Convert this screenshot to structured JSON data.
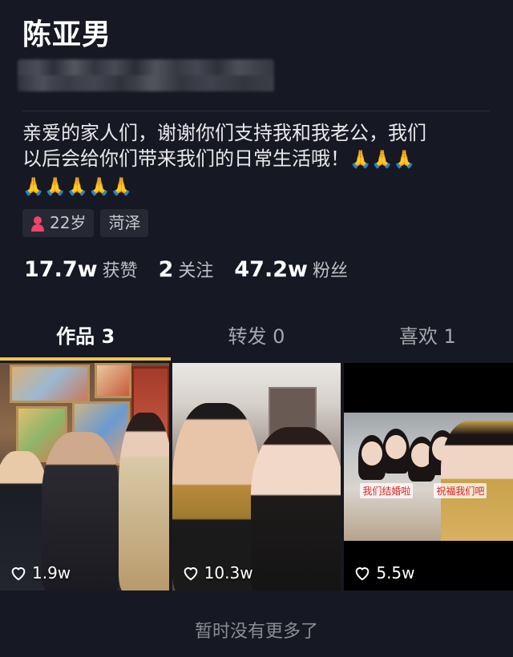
{
  "profile": {
    "name": "陈亚男",
    "bio_line1": "亲爱的家人们，谢谢你们支持我和我老公，我们",
    "bio_line2": "以后会给你们带来我们的日常生活哦！",
    "bio_emoji_line2": "🙏🙏🙏",
    "bio_emoji_line3": "🙏🙏🙏🙏🙏",
    "tags": [
      {
        "icon": "female-icon",
        "label": "22岁"
      },
      {
        "label": "菏泽"
      }
    ]
  },
  "stats": [
    {
      "value": "17.7w",
      "label": "获赞"
    },
    {
      "value": "2",
      "label": "关注"
    },
    {
      "value": "47.2w",
      "label": "粉丝"
    }
  ],
  "tabs": [
    {
      "label": "作品 3",
      "active": true
    },
    {
      "label": "转发 0",
      "active": false
    },
    {
      "label": "喜欢 1",
      "active": false
    }
  ],
  "videos": [
    {
      "likes": "1.9w"
    },
    {
      "likes": "10.3w",
      "captions": []
    },
    {
      "likes": "5.5w",
      "captions": [
        "我们结婚啦",
        "祝福我们吧"
      ]
    }
  ],
  "footer": "暂时没有更多了",
  "colors": {
    "background": "#161823",
    "accent_underline": "#f7c844",
    "female_icon": "#f0436d"
  }
}
